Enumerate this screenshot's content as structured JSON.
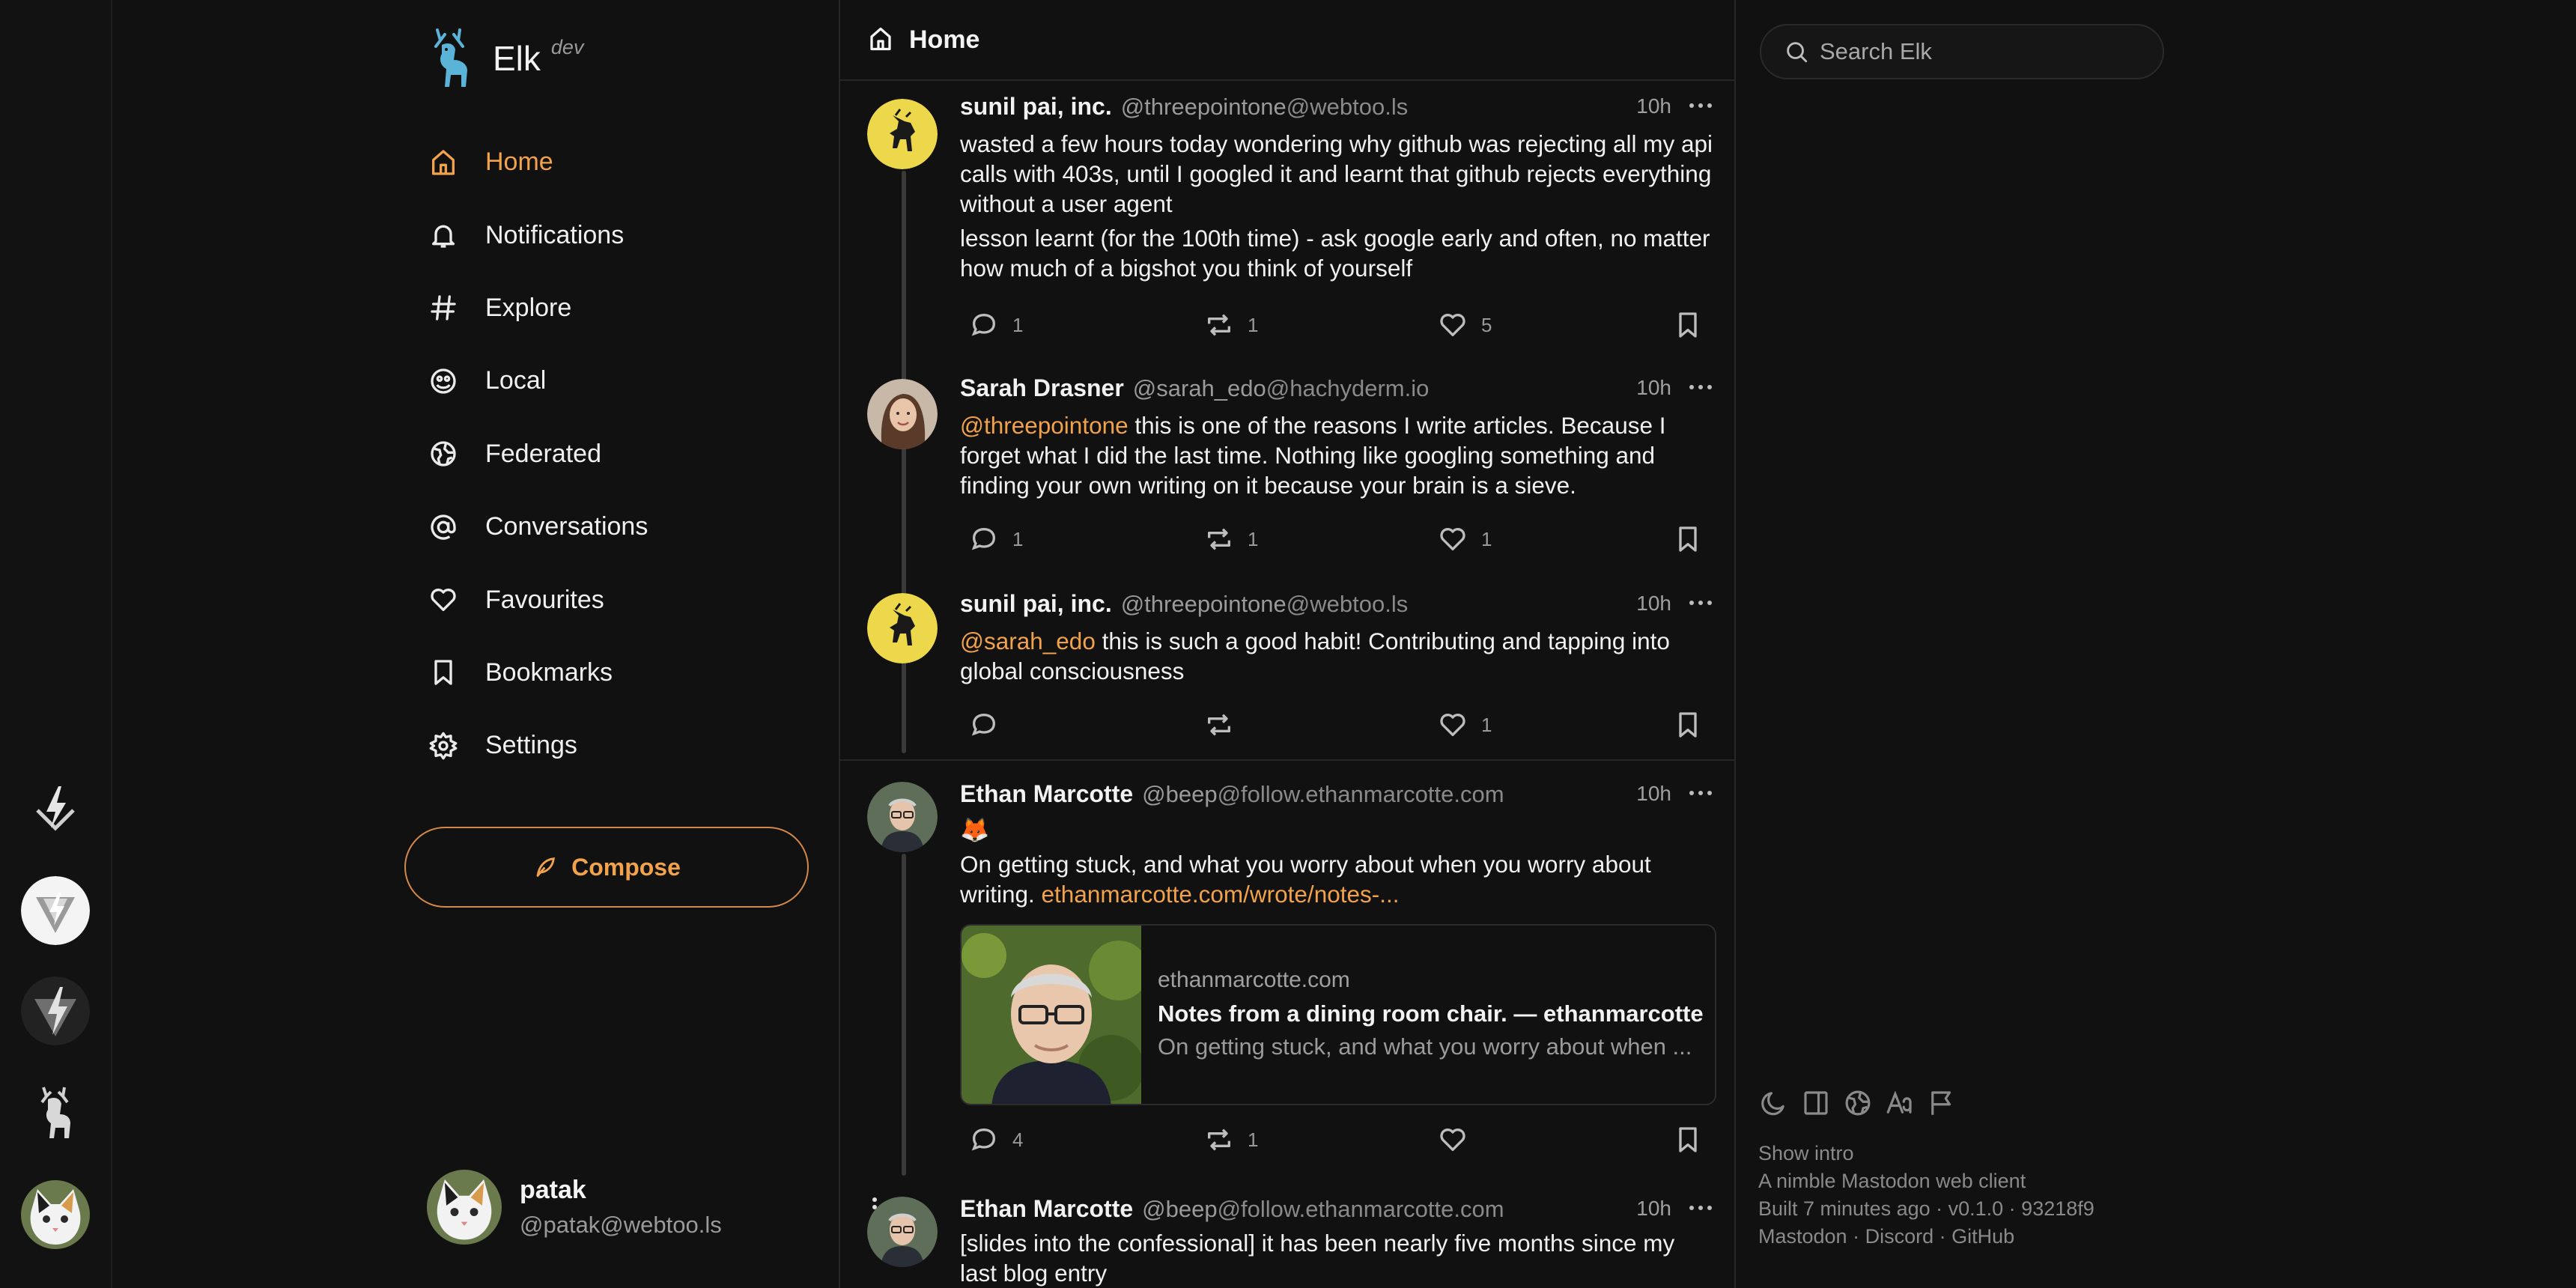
{
  "brand": {
    "name": "Elk",
    "tag": "dev"
  },
  "nav": [
    {
      "label": "Home",
      "icon": "home-icon",
      "active": true
    },
    {
      "label": "Notifications",
      "icon": "bell-icon"
    },
    {
      "label": "Explore",
      "icon": "hashtag-icon"
    },
    {
      "label": "Local",
      "icon": "users-icon"
    },
    {
      "label": "Federated",
      "icon": "globe-icon"
    },
    {
      "label": "Conversations",
      "icon": "at-icon"
    },
    {
      "label": "Favourites",
      "icon": "heart-icon"
    },
    {
      "label": "Bookmarks",
      "icon": "bookmark-icon"
    },
    {
      "label": "Settings",
      "icon": "gear-icon"
    }
  ],
  "compose_label": "Compose",
  "current_user": {
    "name": "patak",
    "handle": "@patak@webtoo.ls"
  },
  "main": {
    "title": "Home"
  },
  "posts": [
    {
      "name": "sunil pai, inc.",
      "handle_user": "@threepointone",
      "handle_domain": "@webtoo.ls",
      "time": "10h",
      "paragraphs": [
        "wasted a few hours today wondering why github was rejecting all my api calls with 403s, until I googled it and learnt that github rejects everything without a user agent",
        "lesson learnt (for the 100th time) - ask google early and often, no matter how much of a bigshot you think of yourself"
      ],
      "counts": {
        "replies": "1",
        "boosts": "1",
        "favourites": "5"
      }
    },
    {
      "name": "Sarah Drasner",
      "handle_user": "@sarah_edo",
      "handle_domain": "@hachyderm.io",
      "time": "10h",
      "mention": "@threepointone",
      "text": " this is one of the reasons I write articles. Because I forget what I did the last time. Nothing like googling something and finding your own writing on it because your brain is a sieve.",
      "counts": {
        "replies": "1",
        "boosts": "1",
        "favourites": "1"
      }
    },
    {
      "name": "sunil pai, inc.",
      "handle_user": "@threepointone",
      "handle_domain": "@webtoo.ls",
      "time": "10h",
      "mention": "@sarah_edo",
      "text": " this is such a good habit! Contributing and tapping into global consciousness",
      "counts": {
        "replies": "",
        "boosts": "",
        "favourites": "1"
      }
    },
    {
      "name": "Ethan Marcotte",
      "handle_user": "@beep",
      "handle_domain": "@follow.ethanmarcotte.com",
      "time": "10h",
      "emoji": "🦊",
      "text": "On getting stuck, and what you worry about when you worry about writing. ",
      "link": "ethanmarcotte.com/wrote/notes-...",
      "card": {
        "domain": "ethanmarcotte.com",
        "title": "Notes from a dining room chair. — ethanmarcotte...",
        "description": "On getting stuck, and what you worry about when ..."
      },
      "counts": {
        "replies": "4",
        "boosts": "1",
        "favourites": ""
      }
    },
    {
      "name": "Ethan Marcotte",
      "handle_user": "@beep",
      "handle_domain": "@follow.ethanmarcotte.com",
      "time": "10h",
      "paragraphs": [
        "[slides into the confessional] it has been nearly five months since my last blog entry"
      ]
    }
  ],
  "search": {
    "placeholder": "Search Elk"
  },
  "footer": {
    "icons": [
      "moon-icon",
      "sidebar-layout-icon",
      "globe-icon",
      "font-size-icon",
      "flag-icon"
    ],
    "show_intro": "Show intro",
    "tagline": "A nimble Mastodon web client",
    "build": "Built 7 minutes ago · v0.1.0 · 93218f9",
    "links": [
      "Mastodon",
      "Discord",
      "GitHub"
    ],
    "sep": " · "
  },
  "colors": {
    "accent": "#f1a24a",
    "background": "#111111",
    "text": "#f0f0f0",
    "muted": "#9a9a9a"
  }
}
